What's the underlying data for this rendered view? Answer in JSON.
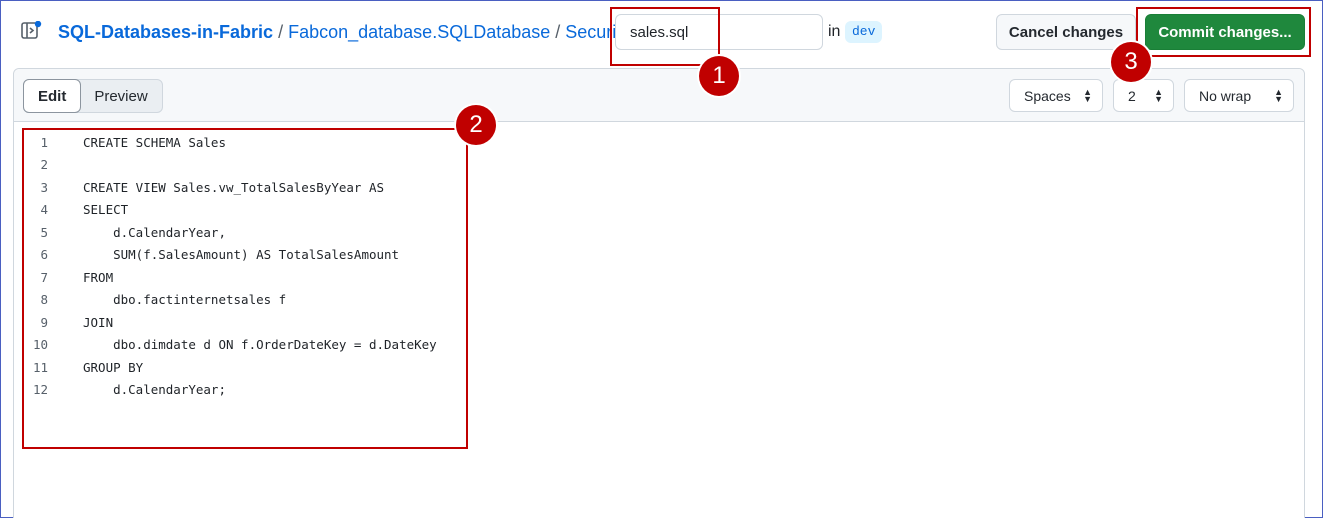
{
  "header": {
    "breadcrumbs": [
      "SQL-Databases-in-Fabric",
      "Fabcon_database.SQLDatabase",
      "Security"
    ],
    "separator": "/",
    "filename_value": "sales.sql",
    "in_label": "in",
    "branch": "dev",
    "cancel_label": "Cancel changes",
    "commit_label": "Commit changes...",
    "colors": {
      "link": "#0969da",
      "commit_bg": "#1f883d",
      "badge_bg": "#ddf4ff"
    }
  },
  "editor": {
    "tabs": [
      {
        "label": "Edit",
        "active": true
      },
      {
        "label": "Preview",
        "active": false
      }
    ],
    "indent_mode": "Spaces",
    "indent_size": "2",
    "wrap_mode": "No wrap",
    "lines": [
      {
        "n": "1",
        "text": "CREATE SCHEMA Sales"
      },
      {
        "n": "2",
        "text": ""
      },
      {
        "n": "3",
        "text": "CREATE VIEW Sales.vw_TotalSalesByYear AS"
      },
      {
        "n": "4",
        "text": "SELECT"
      },
      {
        "n": "5",
        "text": "    d.CalendarYear,"
      },
      {
        "n": "6",
        "text": "    SUM(f.SalesAmount) AS TotalSalesAmount"
      },
      {
        "n": "7",
        "text": "FROM"
      },
      {
        "n": "8",
        "text": "    dbo.factinternetsales f"
      },
      {
        "n": "9",
        "text": "JOIN"
      },
      {
        "n": "10",
        "text": "    dbo.dimdate d ON f.OrderDateKey = d.DateKey"
      },
      {
        "n": "11",
        "text": "GROUP BY"
      },
      {
        "n": "12",
        "text": "    d.CalendarYear;"
      }
    ]
  },
  "annotations": {
    "step_1": "1",
    "step_2": "2",
    "step_3": "3",
    "color": "#c00000"
  }
}
